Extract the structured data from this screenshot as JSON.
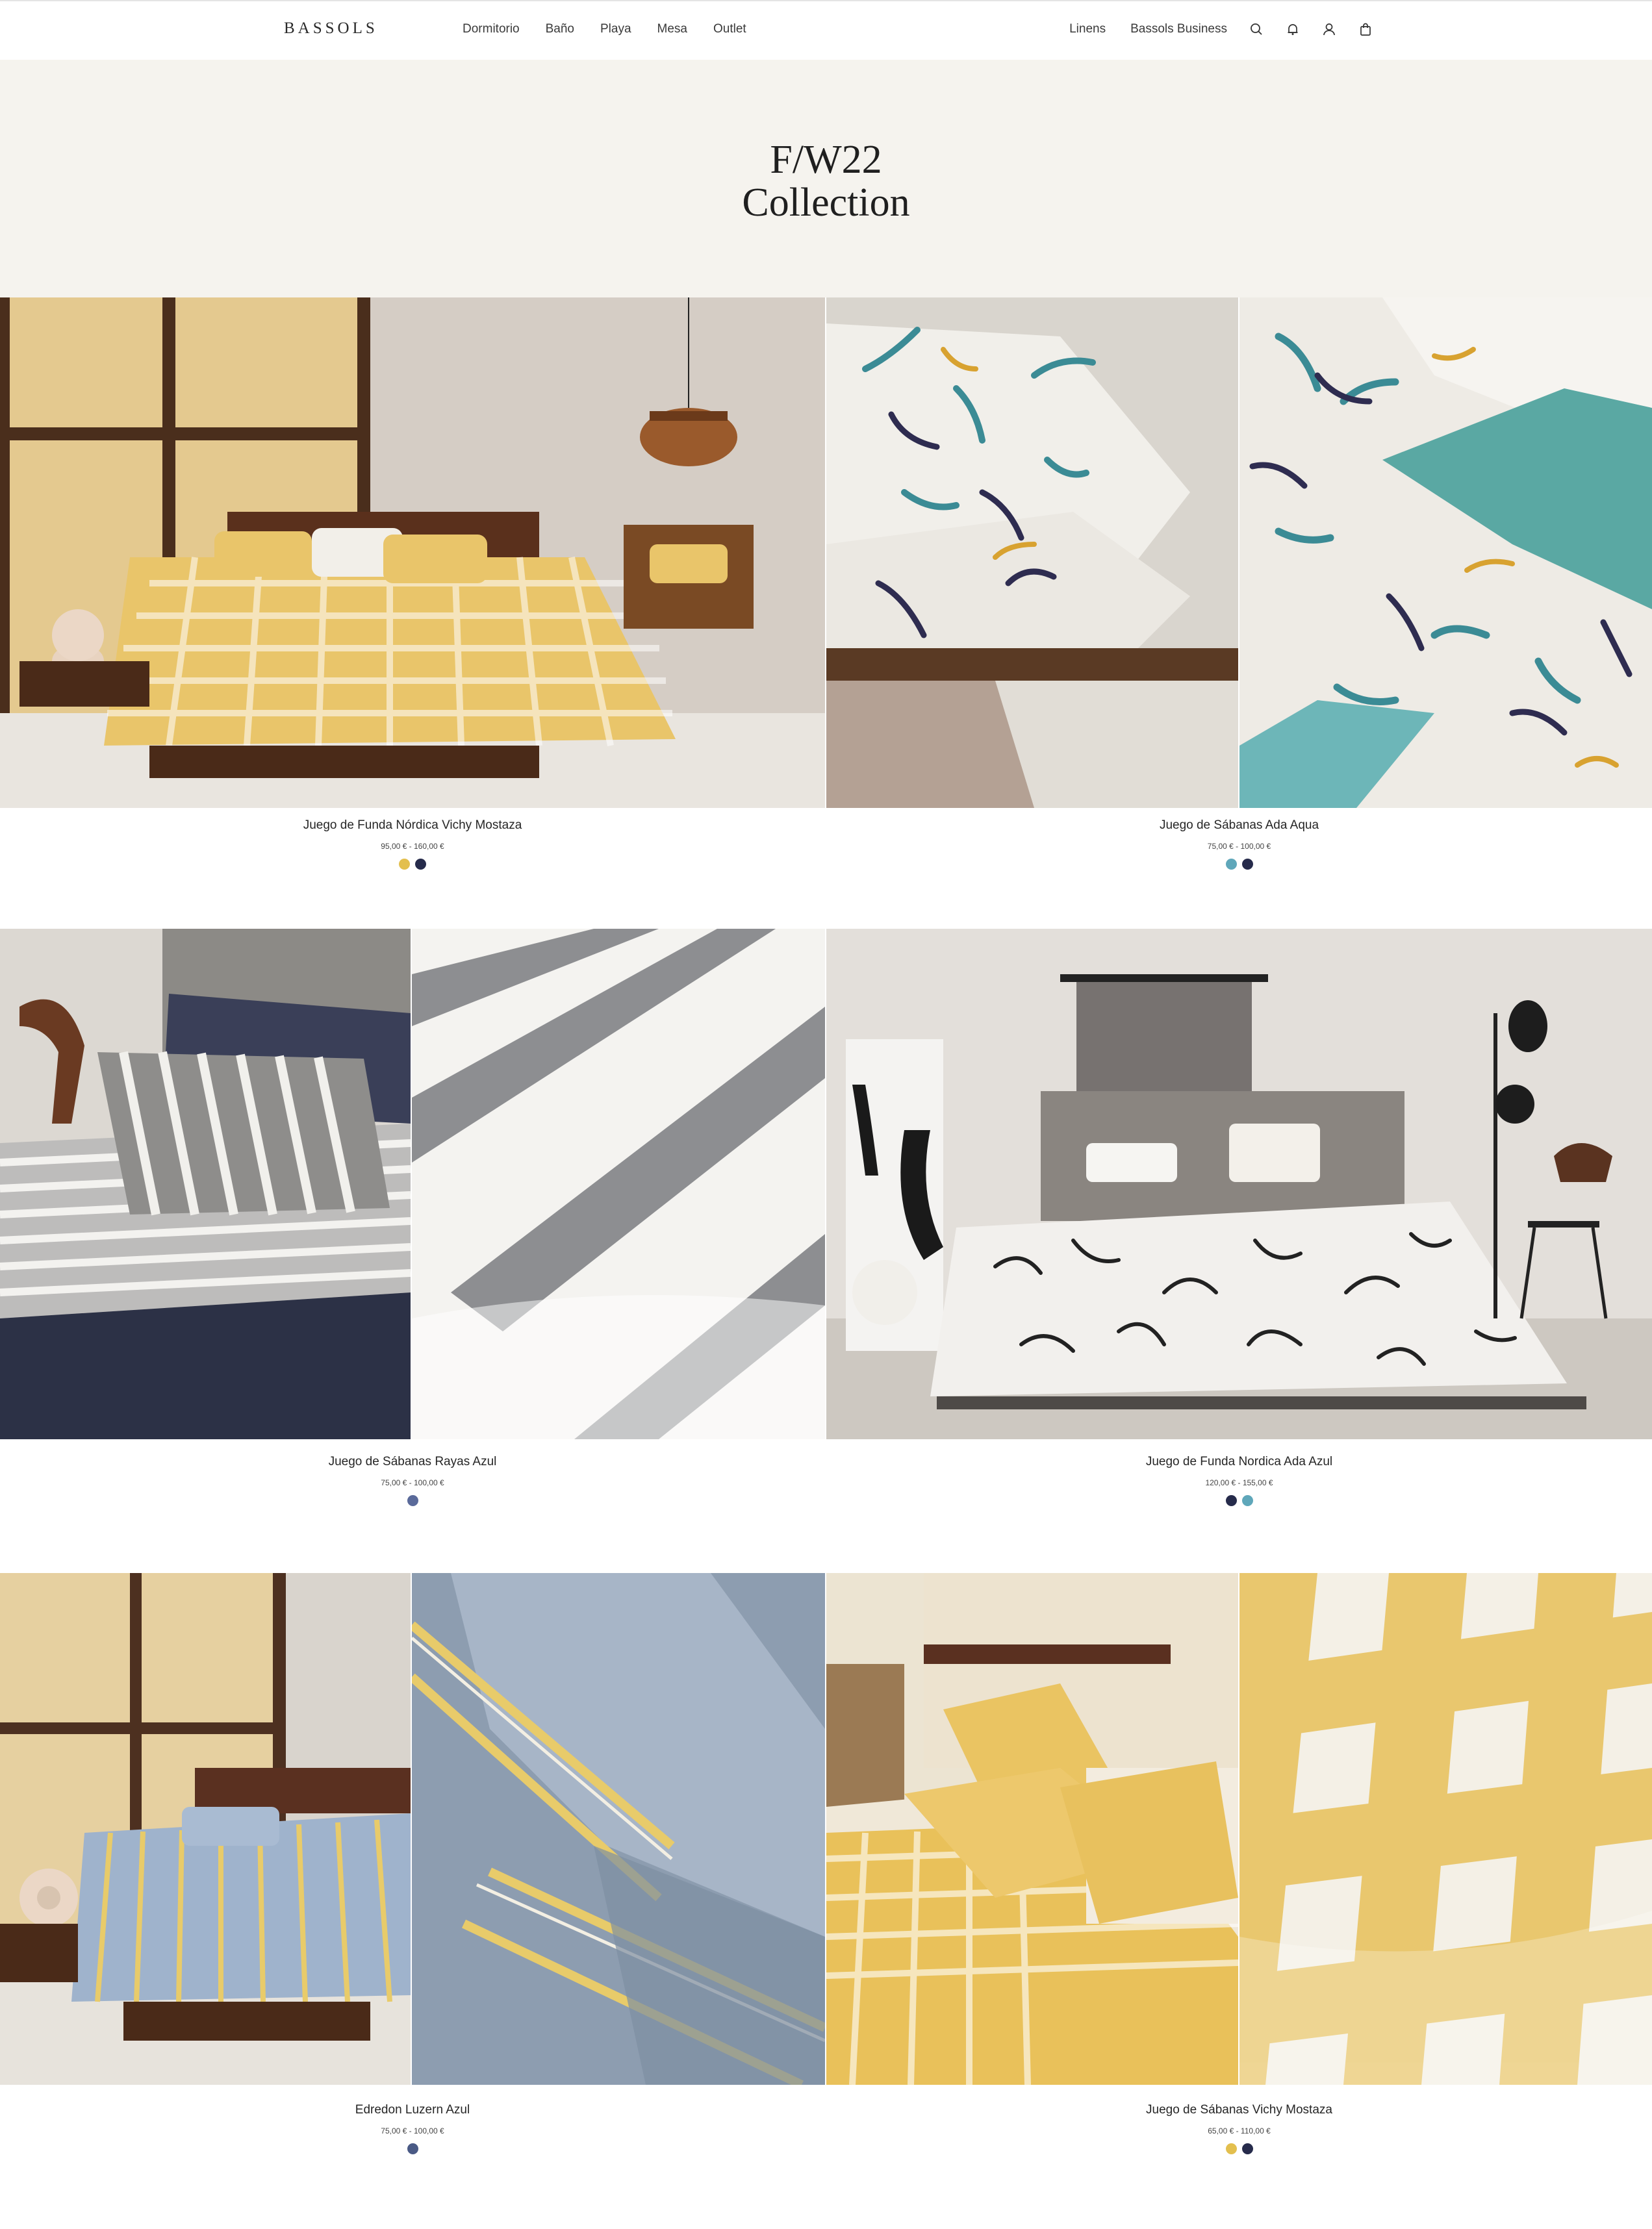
{
  "header": {
    "logo": "BASSOLS",
    "nav_left": [
      "Dormitorio",
      "Baño",
      "Playa",
      "Mesa",
      "Outlet"
    ],
    "nav_right": [
      "Linens",
      "Bassols Business"
    ],
    "icons": [
      "search-icon",
      "bell-icon",
      "user-icon",
      "bag-icon"
    ]
  },
  "hero": {
    "title_line1": "F/W22",
    "title_line2": "Collection"
  },
  "colors": {
    "mustard": "#e3bf4e",
    "navy": "#262b4b",
    "aqua": "#5fa7ba",
    "blue": "#5a6a9a",
    "hero_bg": "#f5f3ee"
  },
  "products": [
    {
      "name": "Juego de Funda Nórdica Vichy Mostaza",
      "price": "95,00 € - 160,00 €",
      "swatches": [
        "#e3bf4e",
        "#262b4b"
      ]
    },
    {
      "name": "Juego de Sábanas Ada Aqua",
      "price": "75,00 € - 100,00 €",
      "swatches": [
        "#5fa7ba",
        "#262b4b"
      ]
    },
    {
      "name": "Juego de Sábanas Rayas Azul",
      "price": "75,00 € - 100,00 €",
      "swatches": [
        "#5a6a9a"
      ]
    },
    {
      "name": "Juego de Funda Nordica Ada Azul",
      "price": "120,00 € - 155,00 €",
      "swatches": [
        "#262b4b",
        "#5fa7ba"
      ]
    },
    {
      "name": "Edredon Luzern Azul",
      "price": "75,00 € - 100,00 €",
      "swatches": [
        "#4a5a85"
      ]
    },
    {
      "name": "Juego de Sábanas Vichy Mostaza",
      "price": "65,00 € - 110,00 €",
      "swatches": [
        "#e3bf4e",
        "#262b4b"
      ]
    }
  ]
}
